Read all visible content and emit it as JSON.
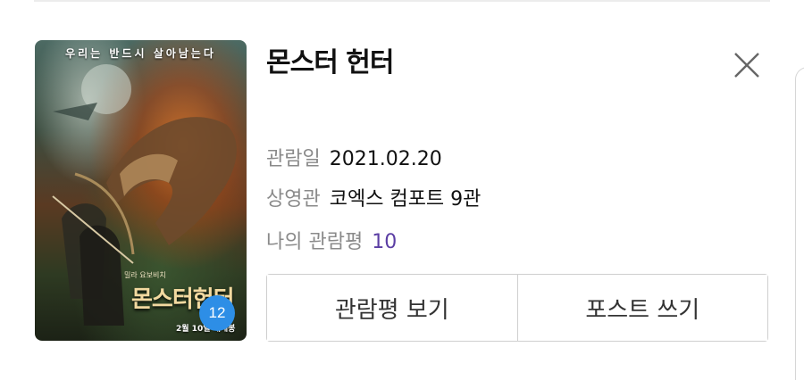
{
  "poster": {
    "tagline": "우리는 반드시 살아남는다",
    "credit": "밀라 요보비치",
    "title": "몬스터헌터",
    "release_date": "2월 10일 대개봉",
    "rating_badge": "12"
  },
  "movie": {
    "title": "몬스터 헌터"
  },
  "details": {
    "date_label": "관람일",
    "date_value": "2021.02.20",
    "theater_label": "상영관",
    "theater_value": "코엑스 컴포트 9관",
    "review_label": "나의 관람평",
    "review_value": "10"
  },
  "actions": {
    "view_review": "관람평 보기",
    "write_post": "포스트 쓰기"
  },
  "colors": {
    "accent_score": "#5b3ea4",
    "rating_badge": "#2d8ee6"
  },
  "icons": {
    "close": "close-icon"
  }
}
